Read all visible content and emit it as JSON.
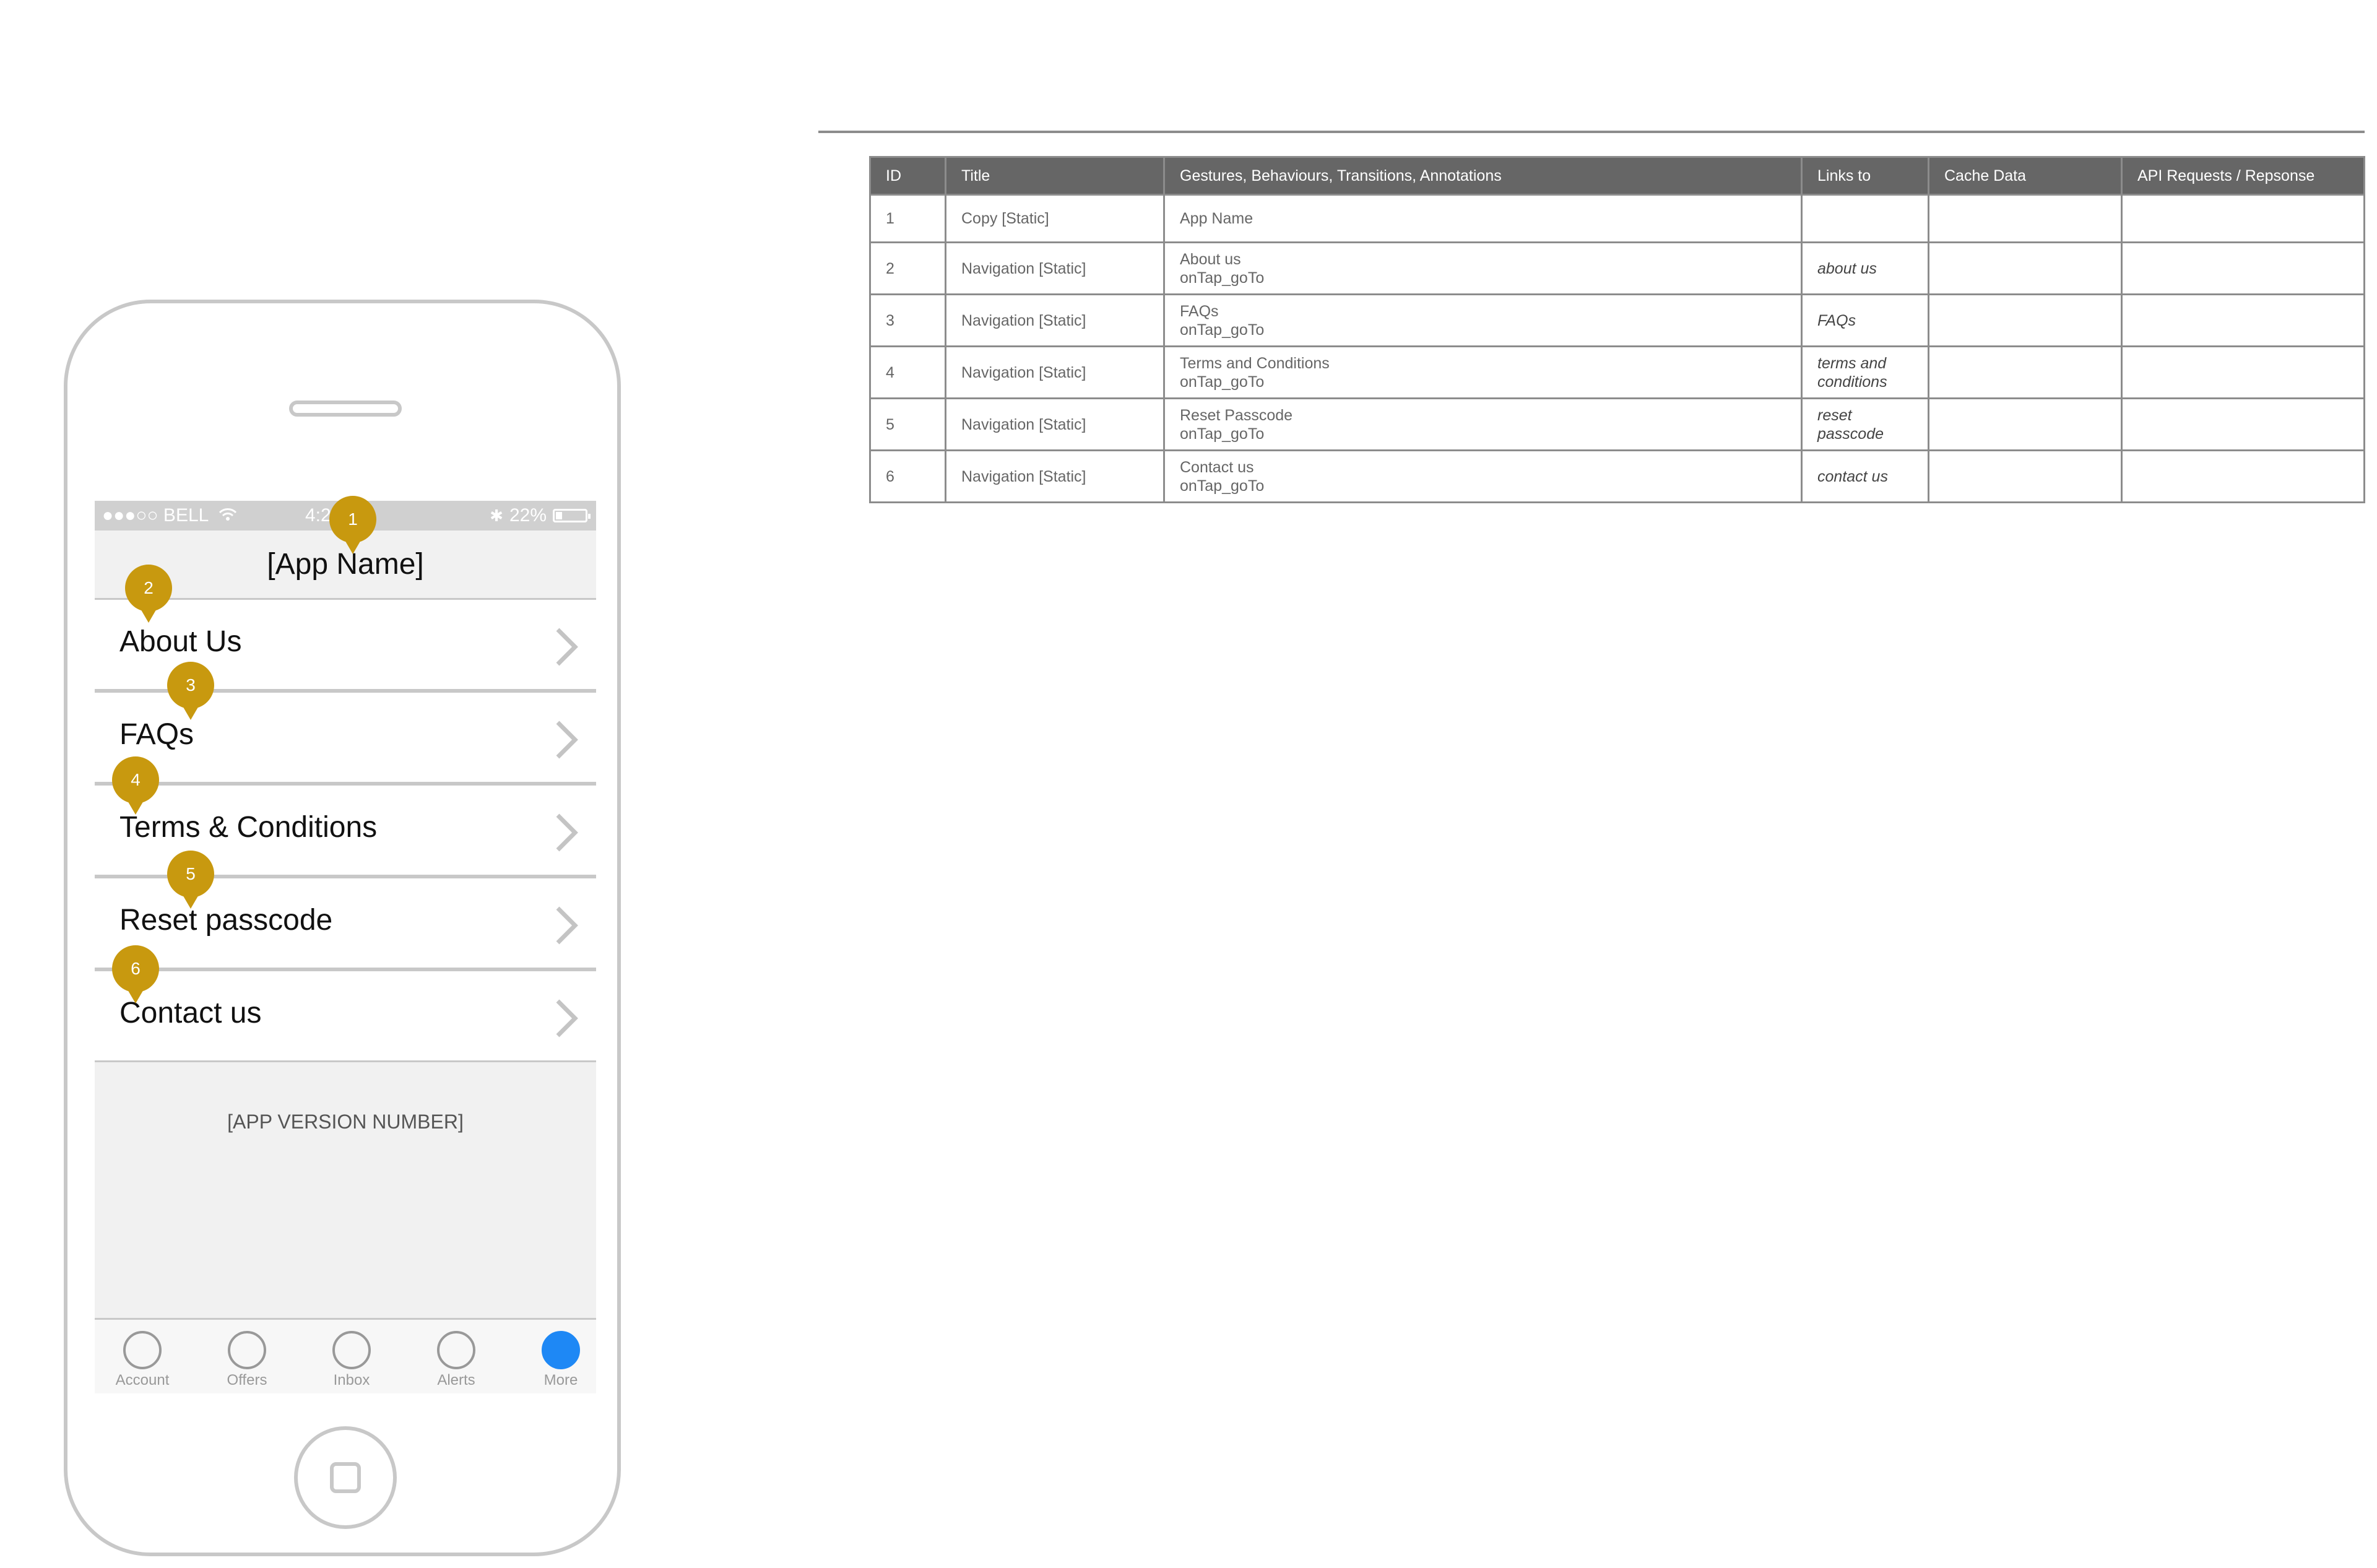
{
  "phone": {
    "status_bar": {
      "carrier": "●●●○○ BELL",
      "time": "4:2",
      "bluetooth": "✱",
      "battery": "22%"
    },
    "app_title": "[App Name]",
    "menu_items": [
      {
        "label": "About Us"
      },
      {
        "label": "FAQs"
      },
      {
        "label": "Terms & Conditions"
      },
      {
        "label": "Reset passcode"
      },
      {
        "label": "Contact us"
      }
    ],
    "version": "[APP VERSION NUMBER]",
    "tabs": [
      {
        "label": "Account",
        "active": false
      },
      {
        "label": "Offers",
        "active": false
      },
      {
        "label": "Inbox",
        "active": false
      },
      {
        "label": "Alerts",
        "active": false
      },
      {
        "label": "More",
        "active": true
      }
    ]
  },
  "markers": [
    "1",
    "2",
    "3",
    "4",
    "5",
    "6"
  ],
  "colors": {
    "marker": "#c8990f",
    "active_tab": "#1e88f5",
    "table_header": "#666666"
  },
  "table": {
    "headers": [
      "ID",
      "Title",
      "Gestures, Behaviours, Transitions, Annotations",
      "Links to",
      "Cache Data",
      "API Requests / Repsonse"
    ],
    "rows": [
      {
        "id": "1",
        "title": "Copy [Static]",
        "gesture1": "App Name",
        "gesture2": "",
        "links1": "",
        "links2": "",
        "cache": "",
        "api": ""
      },
      {
        "id": "2",
        "title": "Navigation [Static]",
        "gesture1": "About us",
        "gesture2": "onTap_goTo",
        "links1": "about us",
        "links2": "",
        "cache": "",
        "api": ""
      },
      {
        "id": "3",
        "title": "Navigation [Static]",
        "gesture1": "FAQs",
        "gesture2": "onTap_goTo",
        "links1": "FAQs",
        "links2": "",
        "cache": "",
        "api": ""
      },
      {
        "id": "4",
        "title": "Navigation [Static]",
        "gesture1": "Terms and Conditions",
        "gesture2": "onTap_goTo",
        "links1": "terms and",
        "links2": "conditions",
        "cache": "",
        "api": ""
      },
      {
        "id": "5",
        "title": "Navigation [Static]",
        "gesture1": "Reset Passcode",
        "gesture2": "onTap_goTo",
        "links1": "reset",
        "links2": "passcode",
        "cache": "",
        "api": ""
      },
      {
        "id": "6",
        "title": "Navigation [Static]",
        "gesture1": "Contact us",
        "gesture2": "onTap_goTo",
        "links1": "contact us",
        "links2": "",
        "cache": "",
        "api": ""
      }
    ]
  }
}
